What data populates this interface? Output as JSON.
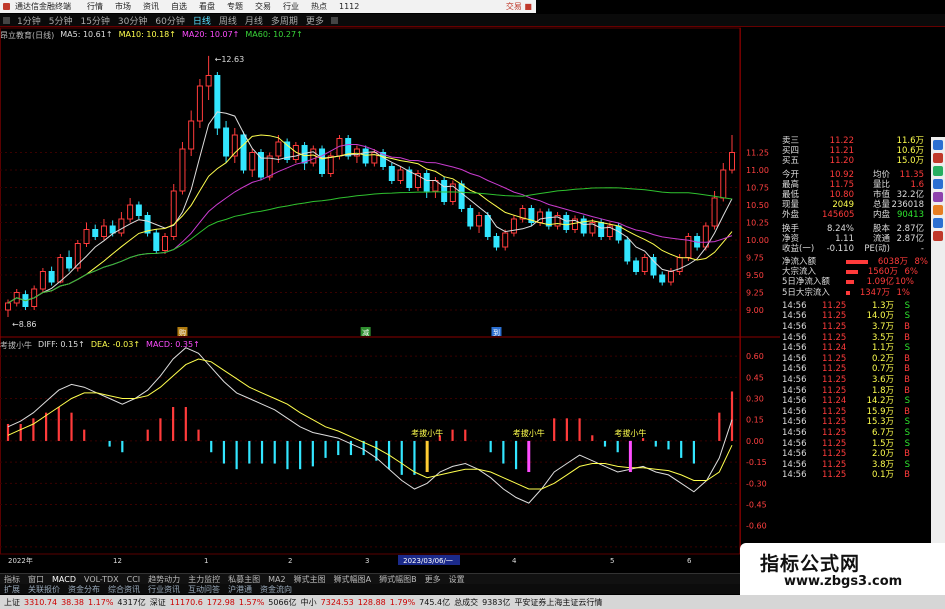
{
  "app": {
    "title": "通达信金融终端",
    "menu": [
      "行情",
      "市场",
      "资讯",
      "自选",
      "看盘",
      "专题",
      "交易",
      "行业",
      "热点",
      "1112"
    ],
    "trade_label": "交易 ■"
  },
  "periods": [
    "1分钟",
    "5分钟",
    "15分钟",
    "30分钟",
    "60分钟",
    "日线",
    "周线",
    "月线",
    "多周期",
    "更多"
  ],
  "active_period": "日线",
  "stock_label": "昂立教育(日线)",
  "ma_legend": [
    {
      "text": "MA5: 10.61↑",
      "color": "#dddddd"
    },
    {
      "text": "MA10: 10.18↑",
      "color": "#ffff4e"
    },
    {
      "text": "MA20: 10.07↑",
      "color": "#ff4dff"
    },
    {
      "text": "MA60: 10.27↑",
      "color": "#39d639"
    }
  ],
  "macd_legend": [
    {
      "text": "考拔小牛",
      "color": "#bbbbbb"
    },
    {
      "text": "DIFF: 0.15↑",
      "color": "#dddddd"
    },
    {
      "text": "DEA: -0.03↑",
      "color": "#ffff4e"
    },
    {
      "text": "MACD: 0.35↑",
      "color": "#ff4dff"
    }
  ],
  "price_annotations": {
    "high": "12.63",
    "low": "8.86"
  },
  "price_axis": [
    "11.25",
    "11.00",
    "10.75",
    "10.50",
    "10.25",
    "10.00",
    "9.75",
    "9.50",
    "9.25",
    "9.00"
  ],
  "macd_axis": [
    "0.60",
    "0.45",
    "0.30",
    "0.15",
    "0.00",
    "-0.15",
    "-0.30",
    "-0.45",
    "-0.60",
    "-0.75"
  ],
  "signals": [
    "考拔小牛",
    "考拔小牛",
    "考拔小牛"
  ],
  "chart_markers": [
    "购",
    "减",
    "到"
  ],
  "date_axis": [
    "2022年",
    "12",
    "1",
    "2",
    "3",
    "2023/03/06/一",
    "4",
    "5",
    "6"
  ],
  "quote": {
    "depth": [
      {
        "k": "卖三",
        "v": "11.22",
        "vol": "11.6万"
      },
      {
        "k": "买四",
        "v": "11.21",
        "vol": "10.6万"
      },
      {
        "k": "买五",
        "v": "11.20",
        "vol": "15.0万"
      }
    ],
    "stats": [
      {
        "k": "今开",
        "v": "10.92",
        "vc": "red",
        "k2": "均价",
        "v2": "11.35",
        "v2c": "red"
      },
      {
        "k": "最高",
        "v": "11.75",
        "vc": "red",
        "k2": "量比",
        "v2": "1.6",
        "v2c": "red"
      },
      {
        "k": "最低",
        "v": "10.80",
        "vc": "red",
        "k2": "市值",
        "v2": "32.2亿",
        "v2c": "wht"
      },
      {
        "k": "现量",
        "v": "2049",
        "vc": "yel",
        "k2": "总量",
        "v2": "236018",
        "v2c": "wht"
      },
      {
        "k": "外盘",
        "v": "145605",
        "vc": "red",
        "k2": "内盘",
        "v2": "90413",
        "v2c": "grn"
      }
    ],
    "stats2": [
      {
        "k": "换手",
        "v": "8.24%",
        "vc": "wht",
        "k2": "股本",
        "v2": "2.87亿",
        "v2c": "wht"
      },
      {
        "k": "净资",
        "v": "1.11",
        "vc": "wht",
        "k2": "流通",
        "v2": "2.87亿",
        "v2c": "wht"
      },
      {
        "k": "收益(一)",
        "v": "-0.110",
        "vc": "wht",
        "k2": "PE(动)",
        "v2": "-",
        "v2c": "wht"
      }
    ],
    "flow": [
      {
        "k": "净流入额",
        "amt": "6038万",
        "pct": "8%",
        "bar": 22
      },
      {
        "k": "大宗流入",
        "amt": "1560万",
        "pct": "6%",
        "bar": 12
      },
      {
        "k": "5日净流入额",
        "amt": "1.09亿",
        "pct": "10%",
        "bar": 8
      },
      {
        "k": "5日大宗流入",
        "amt": "1347万",
        "pct": "1%",
        "bar": 4
      }
    ],
    "trades": [
      {
        "t": "14:56",
        "p": "11.25",
        "vol": "1.3万",
        "bs": "S"
      },
      {
        "t": "14:56",
        "p": "11.25",
        "vol": "14.0万",
        "bs": "S"
      },
      {
        "t": "14:56",
        "p": "11.25",
        "vol": "3.7万",
        "bs": "B"
      },
      {
        "t": "14:56",
        "p": "11.25",
        "vol": "3.5万",
        "bs": "B"
      },
      {
        "t": "14:56",
        "p": "11.24",
        "vol": "1.1万",
        "bs": "S"
      },
      {
        "t": "14:56",
        "p": "11.25",
        "vol": "0.2万",
        "bs": "B"
      },
      {
        "t": "14:56",
        "p": "11.25",
        "vol": "0.7万",
        "bs": "B"
      },
      {
        "t": "14:56",
        "p": "11.25",
        "vol": "3.6万",
        "bs": "B"
      },
      {
        "t": "14:56",
        "p": "11.25",
        "vol": "1.8万",
        "bs": "B"
      },
      {
        "t": "14:56",
        "p": "11.24",
        "vol": "14.2万",
        "bs": "S"
      },
      {
        "t": "14:56",
        "p": "11.25",
        "vol": "15.9万",
        "bs": "B"
      },
      {
        "t": "14:56",
        "p": "11.25",
        "vol": "15.3万",
        "bs": "S"
      },
      {
        "t": "14:56",
        "p": "11.25",
        "vol": "6.7万",
        "bs": "S"
      },
      {
        "t": "14:56",
        "p": "11.25",
        "vol": "1.5万",
        "bs": "S"
      },
      {
        "t": "14:56",
        "p": "11.25",
        "vol": "2.0万",
        "bs": "B"
      },
      {
        "t": "14:56",
        "p": "11.25",
        "vol": "3.8万",
        "bs": "S"
      },
      {
        "t": "14:56",
        "p": "11.25",
        "vol": "0.1万",
        "bs": "B"
      }
    ]
  },
  "bottom_tabs": [
    "指标",
    "窗口",
    "MACD",
    "VOL-TDX",
    "CCI",
    "趋势动力",
    "主力监控",
    "私募主图",
    "MA2",
    "狮式主图",
    "狮式幅图A",
    "狮式幅图B",
    "更多",
    "设置"
  ],
  "bottom_nav": [
    "扩展",
    "关联报价",
    "资金分布",
    "综合资讯",
    "行业资讯",
    "互动问答",
    "沪港通",
    "资金流向"
  ],
  "statusbar": [
    {
      "text": "上证",
      "c": ""
    },
    {
      "text": "3310.74",
      "c": "up"
    },
    {
      "text": "38.38",
      "c": "up"
    },
    {
      "text": "1.17%",
      "c": "up"
    },
    {
      "text": "4317亿",
      "c": ""
    },
    {
      "text": "深证",
      "c": ""
    },
    {
      "text": "11170.6",
      "c": "up"
    },
    {
      "text": "172.98",
      "c": "up"
    },
    {
      "text": "1.57%",
      "c": "up"
    },
    {
      "text": "5066亿",
      "c": ""
    },
    {
      "text": "中小",
      "c": ""
    },
    {
      "text": "7324.53",
      "c": "up"
    },
    {
      "text": "128.88",
      "c": "up"
    },
    {
      "text": "1.79%",
      "c": "up"
    },
    {
      "text": "745.4亿",
      "c": ""
    },
    {
      "text": "总成交",
      "c": ""
    },
    {
      "text": "9383亿",
      "c": ""
    },
    {
      "text": "平安证券上海主证云行情",
      "c": ""
    }
  ],
  "watermark": {
    "title": "指标公式网",
    "url": "www.zbgs3.com"
  },
  "colors": {
    "up": "#ff3b3b",
    "down": "#33e6ff",
    "ma5": "#dddddd",
    "ma10": "#ffff4e",
    "ma20": "#c93ccf",
    "ma60": "#2fc22f",
    "grid": "#5a0000"
  },
  "chart_data": [
    {
      "type": "candlestick",
      "title": "昂立教育(日线)",
      "y_range": [
        8.8,
        12.8
      ],
      "candles": [
        [
          9.0,
          9.1,
          8.9,
          9.15
        ],
        [
          9.1,
          9.25,
          9.05,
          9.3
        ],
        [
          9.22,
          9.05,
          9.0,
          9.28
        ],
        [
          9.05,
          9.3,
          9.0,
          9.35
        ],
        [
          9.3,
          9.55,
          9.25,
          9.6
        ],
        [
          9.55,
          9.4,
          9.35,
          9.62
        ],
        [
          9.4,
          9.75,
          9.38,
          9.8
        ],
        [
          9.75,
          9.6,
          9.55,
          9.85
        ],
        [
          9.6,
          9.95,
          9.55,
          10.0
        ],
        [
          9.95,
          10.15,
          9.9,
          10.25
        ],
        [
          10.15,
          10.05,
          10.0,
          10.22
        ],
        [
          10.05,
          10.2,
          10.0,
          10.3
        ],
        [
          10.2,
          10.1,
          10.05,
          10.28
        ],
        [
          10.1,
          10.3,
          10.05,
          10.4
        ],
        [
          10.3,
          10.5,
          10.25,
          10.6
        ],
        [
          10.5,
          10.35,
          10.3,
          10.55
        ],
        [
          10.35,
          10.1,
          10.05,
          10.4
        ],
        [
          10.1,
          9.85,
          9.8,
          10.15
        ],
        [
          9.85,
          10.05,
          9.8,
          10.1
        ],
        [
          10.05,
          10.7,
          10.0,
          10.8
        ],
        [
          10.7,
          11.3,
          10.65,
          11.4
        ],
        [
          11.3,
          11.7,
          11.2,
          11.85
        ],
        [
          11.7,
          12.2,
          11.6,
          12.3
        ],
        [
          12.2,
          12.35,
          12.0,
          12.63
        ],
        [
          12.35,
          11.6,
          11.5,
          12.4
        ],
        [
          11.6,
          11.2,
          11.1,
          11.7
        ],
        [
          11.2,
          11.5,
          11.1,
          11.6
        ],
        [
          11.5,
          11.0,
          10.95,
          11.55
        ],
        [
          11.0,
          11.25,
          10.9,
          11.3
        ],
        [
          11.25,
          10.9,
          10.85,
          11.3
        ],
        [
          10.9,
          11.2,
          10.85,
          11.25
        ],
        [
          11.2,
          11.4,
          11.1,
          11.5
        ],
        [
          11.4,
          11.15,
          11.1,
          11.45
        ],
        [
          11.15,
          11.35,
          11.1,
          11.4
        ],
        [
          11.35,
          11.1,
          11.0,
          11.4
        ],
        [
          11.1,
          11.3,
          11.05,
          11.35
        ],
        [
          11.3,
          10.95,
          10.9,
          11.35
        ],
        [
          10.95,
          11.2,
          10.9,
          11.25
        ],
        [
          11.2,
          11.45,
          11.15,
          11.5
        ],
        [
          11.45,
          11.2,
          11.15,
          11.5
        ],
        [
          11.2,
          11.3,
          11.1,
          11.35
        ],
        [
          11.3,
          11.1,
          11.05,
          11.35
        ],
        [
          11.1,
          11.25,
          11.05,
          11.3
        ],
        [
          11.25,
          11.05,
          11.0,
          11.3
        ],
        [
          11.05,
          10.85,
          10.8,
          11.1
        ],
        [
          10.85,
          11.0,
          10.8,
          11.05
        ],
        [
          11.0,
          10.75,
          10.7,
          11.05
        ],
        [
          10.75,
          10.95,
          10.7,
          11.0
        ],
        [
          10.95,
          10.7,
          10.6,
          11.0
        ],
        [
          10.7,
          10.85,
          10.6,
          10.9
        ],
        [
          10.85,
          10.55,
          10.5,
          10.9
        ],
        [
          10.55,
          10.8,
          10.5,
          10.85
        ],
        [
          10.8,
          10.45,
          10.4,
          10.85
        ],
        [
          10.45,
          10.2,
          10.15,
          10.5
        ],
        [
          10.2,
          10.35,
          10.1,
          10.4
        ],
        [
          10.35,
          10.05,
          10.0,
          10.4
        ],
        [
          10.05,
          9.9,
          9.85,
          10.1
        ],
        [
          9.9,
          10.1,
          9.85,
          10.15
        ],
        [
          10.1,
          10.3,
          10.05,
          10.35
        ],
        [
          10.3,
          10.45,
          10.25,
          10.5
        ],
        [
          10.45,
          10.25,
          10.2,
          10.5
        ],
        [
          10.25,
          10.4,
          10.2,
          10.45
        ],
        [
          10.4,
          10.2,
          10.15,
          10.45
        ],
        [
          10.2,
          10.35,
          10.15,
          10.4
        ],
        [
          10.35,
          10.15,
          10.1,
          10.4
        ],
        [
          10.15,
          10.3,
          10.1,
          10.35
        ],
        [
          10.3,
          10.1,
          10.05,
          10.35
        ],
        [
          10.1,
          10.25,
          10.05,
          10.3
        ],
        [
          10.25,
          10.05,
          10.0,
          10.3
        ],
        [
          10.05,
          10.2,
          10.0,
          10.25
        ],
        [
          10.2,
          10.0,
          9.95,
          10.25
        ],
        [
          10.0,
          9.7,
          9.65,
          10.05
        ],
        [
          9.7,
          9.55,
          9.5,
          9.75
        ],
        [
          9.55,
          9.75,
          9.5,
          9.8
        ],
        [
          9.75,
          9.5,
          9.45,
          9.8
        ],
        [
          9.5,
          9.4,
          9.35,
          9.55
        ],
        [
          9.4,
          9.55,
          9.35,
          9.6
        ],
        [
          9.55,
          9.75,
          9.5,
          9.8
        ],
        [
          9.75,
          10.05,
          9.7,
          10.1
        ],
        [
          10.05,
          9.9,
          9.85,
          10.1
        ],
        [
          9.9,
          10.2,
          9.85,
          10.25
        ],
        [
          10.2,
          10.6,
          10.15,
          10.7
        ],
        [
          10.6,
          11.0,
          10.55,
          11.1
        ],
        [
          11.0,
          11.25,
          10.95,
          11.5
        ]
      ]
    },
    {
      "type": "bar",
      "title": "考拔小牛",
      "y_range": [
        -0.8,
        0.7
      ],
      "series": [
        {
          "name": "DIFF",
          "values": [
            0.1,
            0.14,
            0.2,
            0.28,
            0.36,
            0.4,
            0.38,
            0.34,
            0.3,
            0.26,
            0.3,
            0.36,
            0.46,
            0.58,
            0.66,
            0.62,
            0.52,
            0.42,
            0.34,
            0.3,
            0.26,
            0.22,
            0.16,
            0.1,
            0.06,
            0.04,
            0.02,
            -0.02,
            -0.06,
            -0.12,
            -0.2,
            -0.28,
            -0.34,
            -0.3,
            -0.22,
            -0.18,
            -0.16,
            -0.2,
            -0.26,
            -0.34,
            -0.4,
            -0.44,
            -0.34,
            -0.22,
            -0.16,
            -0.1,
            -0.14,
            -0.18,
            -0.22,
            -0.2,
            -0.18,
            -0.22,
            -0.24,
            -0.3,
            -0.36,
            -0.28,
            -0.12,
            0.15
          ]
        },
        {
          "name": "DEA",
          "values": [
            0.04,
            0.08,
            0.12,
            0.18,
            0.24,
            0.3,
            0.34,
            0.34,
            0.32,
            0.3,
            0.3,
            0.32,
            0.38,
            0.46,
            0.54,
            0.58,
            0.56,
            0.5,
            0.44,
            0.38,
            0.34,
            0.3,
            0.26,
            0.2,
            0.15,
            0.1,
            0.07,
            0.03,
            -0.01,
            -0.05,
            -0.1,
            -0.16,
            -0.22,
            -0.26,
            -0.24,
            -0.22,
            -0.2,
            -0.2,
            -0.22,
            -0.26,
            -0.3,
            -0.34,
            -0.34,
            -0.3,
            -0.24,
            -0.18,
            -0.16,
            -0.16,
            -0.18,
            -0.19,
            -0.19,
            -0.2,
            -0.21,
            -0.24,
            -0.28,
            -0.28,
            -0.22,
            -0.03
          ]
        },
        {
          "name": "MACD",
          "values": [
            0.12,
            0.12,
            0.16,
            0.2,
            0.24,
            0.2,
            0.08,
            0.0,
            -0.04,
            -0.08,
            0.0,
            0.08,
            0.16,
            0.24,
            0.24,
            0.08,
            -0.08,
            -0.16,
            -0.2,
            -0.16,
            -0.16,
            -0.16,
            -0.2,
            -0.2,
            -0.18,
            -0.12,
            -0.1,
            -0.1,
            -0.1,
            -0.14,
            -0.2,
            -0.24,
            -0.24,
            -0.08,
            0.04,
            0.08,
            0.08,
            0.0,
            -0.08,
            -0.16,
            -0.2,
            -0.2,
            0.0,
            0.16,
            0.16,
            0.16,
            0.04,
            -0.04,
            -0.08,
            -0.02,
            0.02,
            -0.04,
            -0.06,
            -0.12,
            -0.16,
            0.0,
            0.2,
            0.35
          ]
        }
      ]
    }
  ]
}
